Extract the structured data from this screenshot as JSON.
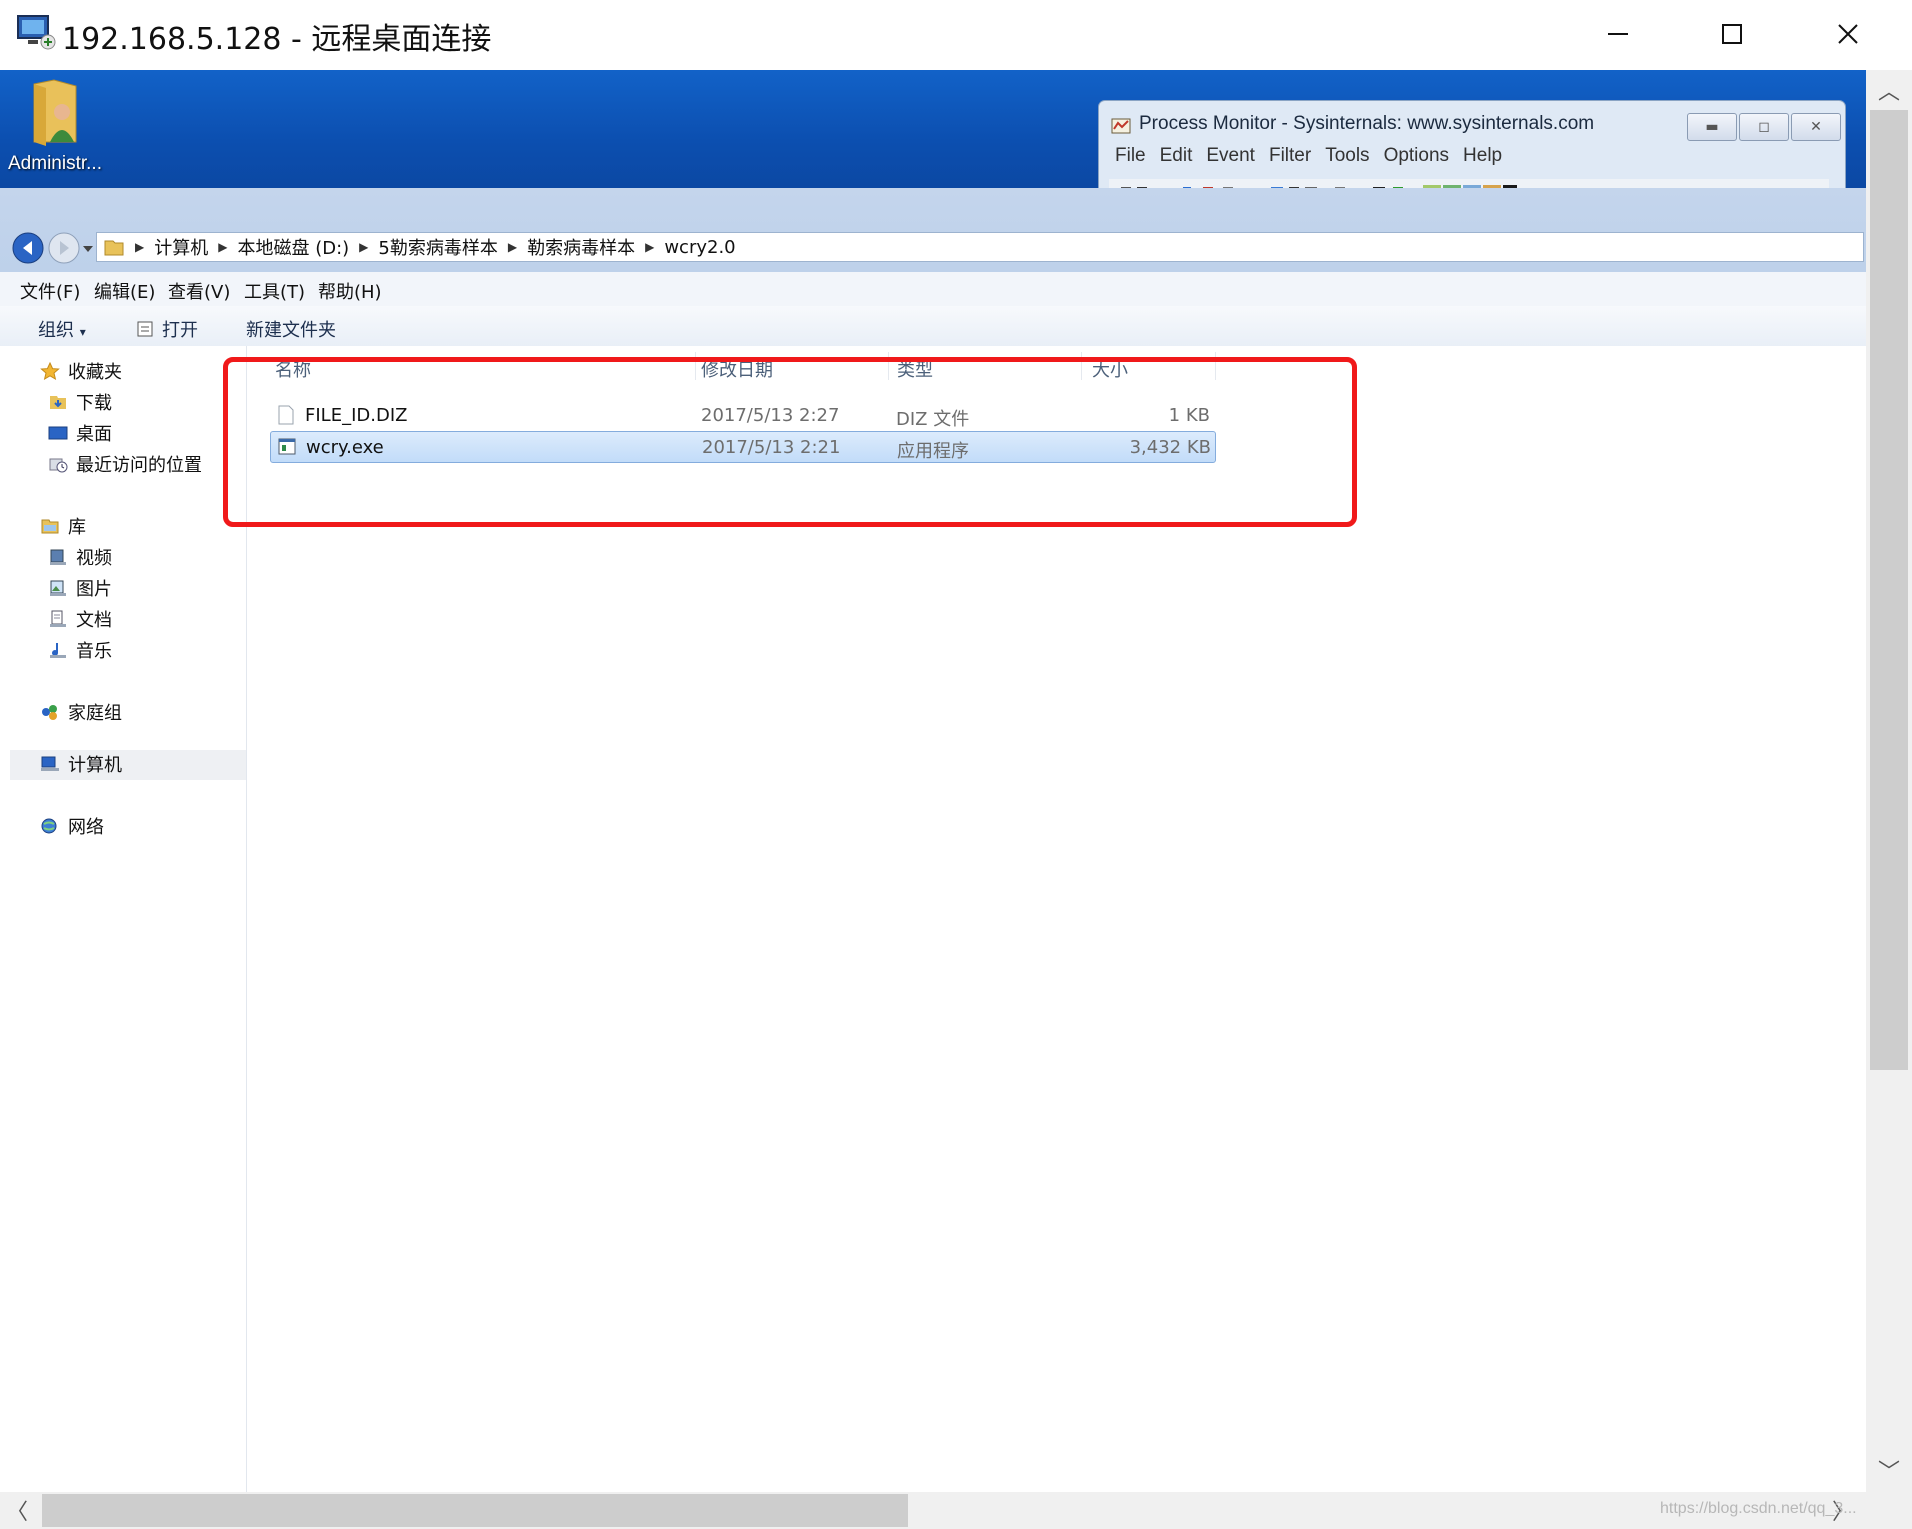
{
  "rdp": {
    "title": "192.168.5.128 - 远程桌面连接",
    "minimize_glyph": "─",
    "maximize_glyph": "☐",
    "close_glyph": "✕"
  },
  "desktop": {
    "icon_label": "Administr..."
  },
  "procmon": {
    "title": "Process Monitor - Sysinternals: www.sysinternals.com",
    "menu": [
      "File",
      "Edit",
      "Event",
      "Filter",
      "Tools",
      "Options",
      "Help"
    ],
    "btn_min": "▬",
    "btn_max": "◻",
    "btn_close": "✕"
  },
  "explorer": {
    "breadcrumb": [
      "计算机",
      "本地磁盘 (D:)",
      "5勒索病毒样本",
      "勒索病毒样本",
      "wcry2.0"
    ],
    "menu": [
      "文件(F)",
      "编辑(E)",
      "查看(V)",
      "工具(T)",
      "帮助(H)"
    ],
    "commands": {
      "organize": "组织",
      "organize_caret": "▾",
      "open": "打开",
      "new_folder": "新建文件夹"
    },
    "nav": {
      "favorites": "收藏夹",
      "downloads": "下载",
      "desktop": "桌面",
      "recent": "最近访问的位置",
      "libraries": "库",
      "videos": "视频",
      "pictures": "图片",
      "documents": "文档",
      "music": "音乐",
      "homegroup": "家庭组",
      "computer": "计算机",
      "network": "网络"
    },
    "columns": {
      "name": "名称",
      "modified": "修改日期",
      "type": "类型",
      "size": "大小"
    },
    "files": [
      {
        "name": "FILE_ID.DIZ",
        "modified": "2017/5/13 2:27",
        "type": "DIZ 文件",
        "size": "1 KB"
      },
      {
        "name": "wcry.exe",
        "modified": "2017/5/13 2:21",
        "type": "应用程序",
        "size": "3,432 KB"
      }
    ]
  },
  "scroll": {
    "up": "︿",
    "down": "﹀",
    "left": "〈",
    "right": "〉"
  },
  "watermark": "https://blog.csdn.net/qq_3..."
}
